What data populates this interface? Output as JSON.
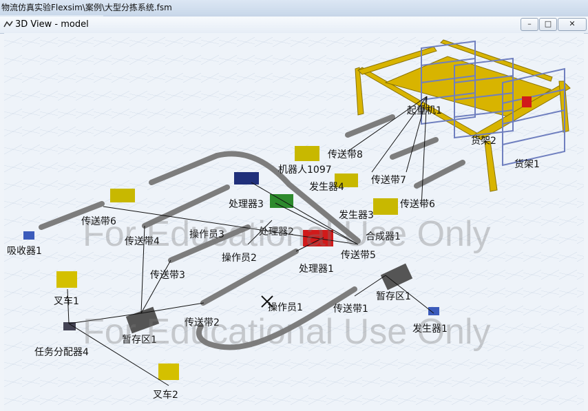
{
  "app": {
    "title": "物流仿真实验Flexsim\\案例\\大型分拣系统.fsm"
  },
  "window": {
    "title": "3D View - model",
    "btn_min": "–",
    "btn_max": "□",
    "btn_close": "✕"
  },
  "watermark": {
    "text": "For Educational Use Only"
  },
  "objects": {
    "crane": "起重机1",
    "rack2": "货架2",
    "rack1": "货架1",
    "conveyor8": "传送带8",
    "robot": "机器人1097",
    "conveyor7": "传送带7",
    "source4": "发生器4",
    "conveyor6a": "传送带6",
    "processor3": "处理器3",
    "source3": "发生器3",
    "conveyor6b": "传送带6",
    "processor2": "处理器2",
    "combiner": "合成器1",
    "operator3": "操作员3",
    "conveyor4": "传送带4",
    "sink": "吸收器1",
    "operator2": "操作员2",
    "conveyor5": "传送带5",
    "processor1": "处理器1",
    "conveyor3": "传送带3",
    "forklift1": "叉车1",
    "queue1a": "暂存区1",
    "operator1": "操作员1",
    "conveyor1": "传送带1",
    "conveyor2": "传送带2",
    "source1": "发生器1",
    "queue1b": "暂存区1",
    "dispatcher": "任务分配器4",
    "forklift2": "叉车2"
  },
  "colors": {
    "crane": "#d8b400",
    "conveyor": "#8b8b8b",
    "rack": "#7f8fc8",
    "processor_red": "#d11a1a"
  }
}
